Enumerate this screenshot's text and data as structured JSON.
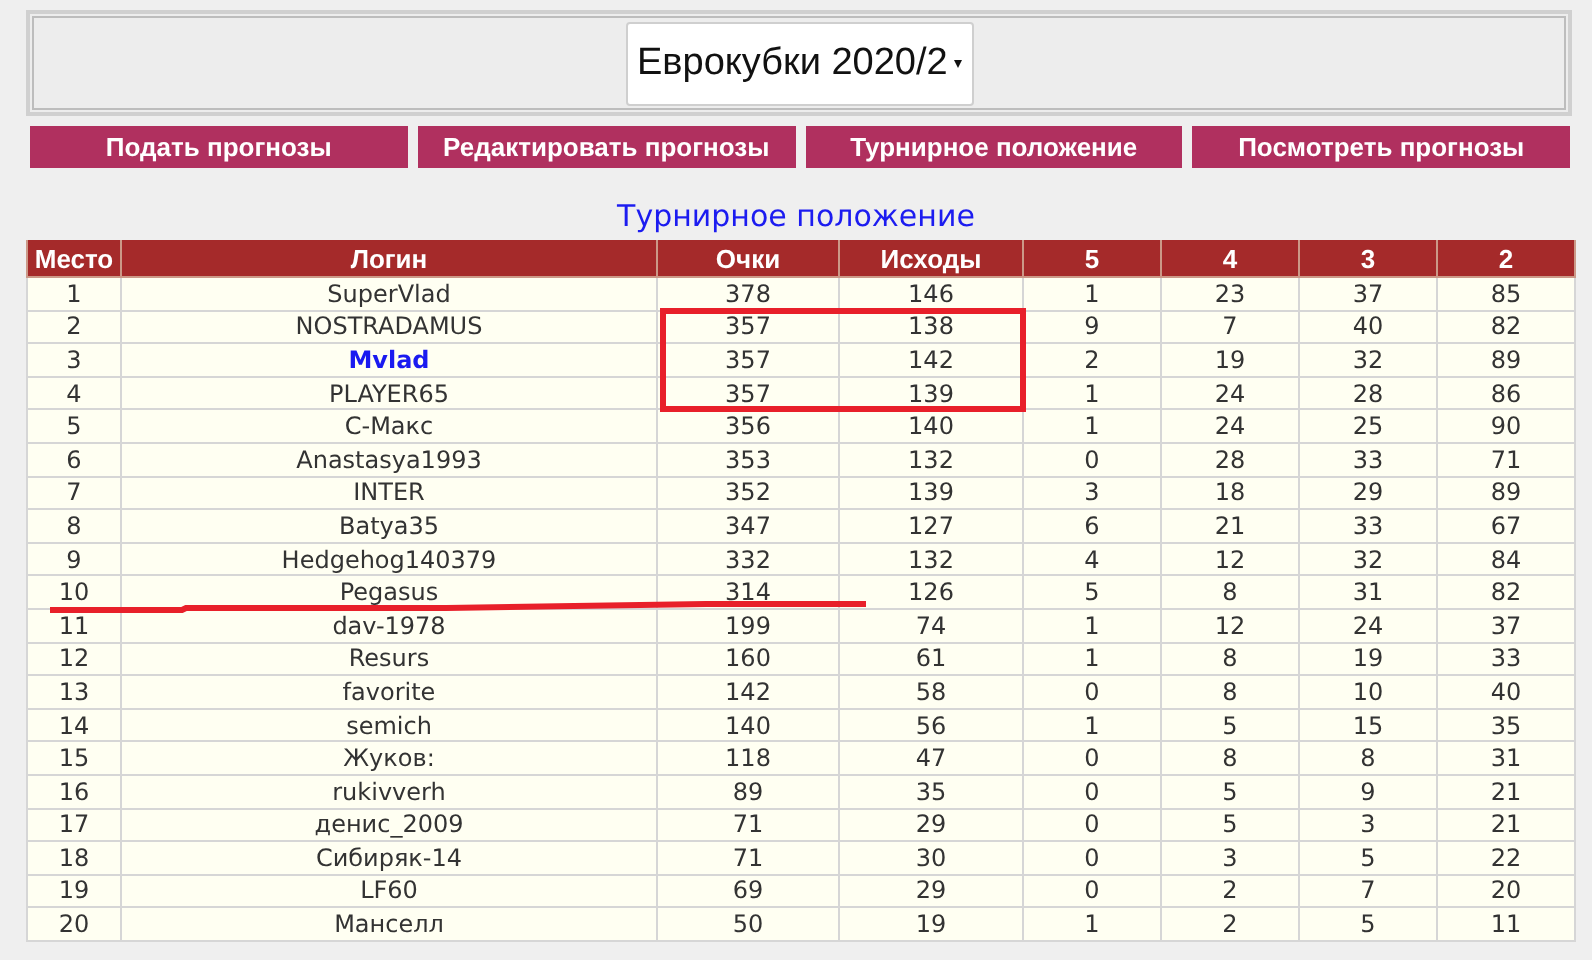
{
  "season_select": {
    "value": "Еврокубки 2020/2"
  },
  "nav_buttons": [
    "Подать прогнозы",
    "Редактировать прогнозы",
    "Турнирное положение",
    "Посмотреть прогнозы"
  ],
  "title": "Турнирное положение",
  "table": {
    "columns": [
      "Место",
      "Логин",
      "Очки",
      "Исходы",
      "5",
      "4",
      "3",
      "2"
    ],
    "rows": [
      {
        "cells": [
          "1",
          "SuperVlad",
          "378",
          "146",
          "1",
          "23",
          "37",
          "85"
        ],
        "current": false,
        "framed": false,
        "underlined": false
      },
      {
        "cells": [
          "2",
          "NOSTRADAMUS",
          "357",
          "138",
          "9",
          "7",
          "40",
          "82"
        ],
        "current": false,
        "framed": true,
        "underlined": false
      },
      {
        "cells": [
          "3",
          "Mvlad",
          "357",
          "142",
          "2",
          "19",
          "32",
          "89"
        ],
        "current": true,
        "framed": true,
        "underlined": false
      },
      {
        "cells": [
          "4",
          "PLAYER65",
          "357",
          "139",
          "1",
          "24",
          "28",
          "86"
        ],
        "current": false,
        "framed": true,
        "underlined": false
      },
      {
        "cells": [
          "5",
          "С-Макс",
          "356",
          "140",
          "1",
          "24",
          "25",
          "90"
        ],
        "current": false,
        "framed": false,
        "underlined": false
      },
      {
        "cells": [
          "6",
          "Anastasya1993",
          "353",
          "132",
          "0",
          "28",
          "33",
          "71"
        ],
        "current": false,
        "framed": false,
        "underlined": false
      },
      {
        "cells": [
          "7",
          "INTER",
          "352",
          "139",
          "3",
          "18",
          "29",
          "89"
        ],
        "current": false,
        "framed": false,
        "underlined": false
      },
      {
        "cells": [
          "8",
          "Batya35",
          "347",
          "127",
          "6",
          "21",
          "33",
          "67"
        ],
        "current": false,
        "framed": false,
        "underlined": false
      },
      {
        "cells": [
          "9",
          "Hedgehog140379",
          "332",
          "132",
          "4",
          "12",
          "32",
          "84"
        ],
        "current": false,
        "framed": false,
        "underlined": false
      },
      {
        "cells": [
          "10",
          "Pegasus",
          "314",
          "126",
          "5",
          "8",
          "31",
          "82"
        ],
        "current": false,
        "framed": false,
        "underlined": true
      },
      {
        "cells": [
          "11",
          "dav-1978",
          "199",
          "74",
          "1",
          "12",
          "24",
          "37"
        ],
        "current": false,
        "framed": false,
        "underlined": false
      },
      {
        "cells": [
          "12",
          "Resurs",
          "160",
          "61",
          "1",
          "8",
          "19",
          "33"
        ],
        "current": false,
        "framed": false,
        "underlined": false
      },
      {
        "cells": [
          "13",
          "favorite",
          "142",
          "58",
          "0",
          "8",
          "10",
          "40"
        ],
        "current": false,
        "framed": false,
        "underlined": false
      },
      {
        "cells": [
          "14",
          "semich",
          "140",
          "56",
          "1",
          "5",
          "15",
          "35"
        ],
        "current": false,
        "framed": false,
        "underlined": false
      },
      {
        "cells": [
          "15",
          "Жуков:",
          "118",
          "47",
          "0",
          "8",
          "8",
          "31"
        ],
        "current": false,
        "framed": false,
        "underlined": false
      },
      {
        "cells": [
          "16",
          "rukivverh",
          "89",
          "35",
          "0",
          "5",
          "9",
          "21"
        ],
        "current": false,
        "framed": false,
        "underlined": false
      },
      {
        "cells": [
          "17",
          "денис_2009",
          "71",
          "29",
          "0",
          "5",
          "3",
          "21"
        ],
        "current": false,
        "framed": false,
        "underlined": false
      },
      {
        "cells": [
          "18",
          "Сибиряк-14",
          "71",
          "30",
          "0",
          "3",
          "5",
          "22"
        ],
        "current": false,
        "framed": false,
        "underlined": false
      },
      {
        "cells": [
          "19",
          "LF60",
          "69",
          "29",
          "0",
          "2",
          "7",
          "20"
        ],
        "current": false,
        "framed": false,
        "underlined": false
      },
      {
        "cells": [
          "20",
          "Манселл",
          "50",
          "19",
          "1",
          "2",
          "5",
          "11"
        ],
        "current": false,
        "framed": false,
        "underlined": false
      }
    ]
  }
}
